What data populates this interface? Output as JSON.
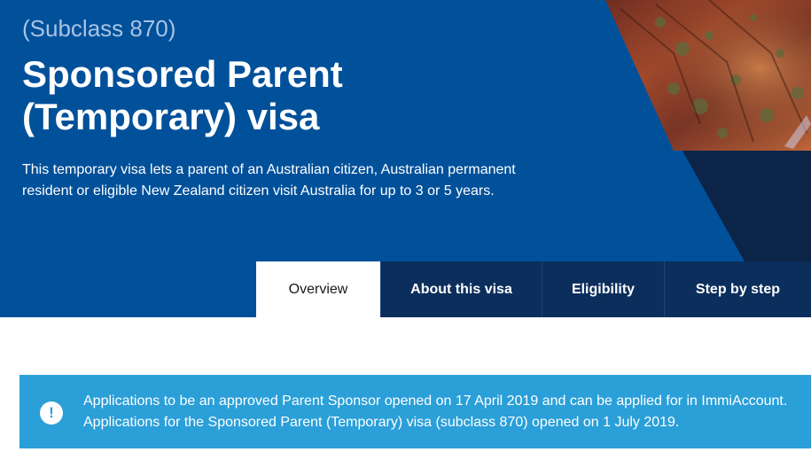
{
  "hero": {
    "subclass": "(Subclass 870)",
    "title_line1": "Sponsored Parent",
    "title_line2": "(Temporary) visa",
    "description": "This temporary visa lets a parent of an Australian citizen, Australian permanent resident or eligible New Zealand citizen visit Australia for up to 3 or 5 years."
  },
  "tabs": [
    {
      "label": "Overview",
      "active": true
    },
    {
      "label": "About this visa",
      "active": false
    },
    {
      "label": "Eligibility",
      "active": false
    },
    {
      "label": "Step by step",
      "active": false
    }
  ],
  "alert": {
    "icon": "exclamation-icon",
    "line1": "Applications to be an approved Parent Sponsor opened on 17 April 2019 and can be applied for in ImmiAccount.",
    "line2": "Applications for the Sponsored Parent (Temporary) visa (subclass 870) opened on 1 July 2019."
  },
  "colors": {
    "hero_blue": "#00509a",
    "tab_navy": "#0b2e5c",
    "alert_blue": "#2a9fd8"
  }
}
